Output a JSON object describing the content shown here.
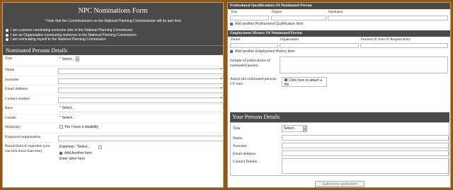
{
  "left": {
    "title": "NPC Nominations Form",
    "note": "* Note that the Commissioners on the National Planning Commissioner will be part time",
    "radios": [
      "I am a person nominating someone else to the National Planning Commission",
      "I am an Organisation nominating someone to the National Planning Commission",
      "I am nominating myself to the National Planning Commission"
    ],
    "section_title": "Nominated Persons Details",
    "fields": {
      "title": "Title",
      "title_select": "Select...",
      "name": "Name",
      "surname": "Surname",
      "email": "Email Address",
      "contact": "Contact number",
      "race": "Race",
      "race_select": "Select...",
      "gender": "Gender",
      "gender_select": "Select...",
      "disability": "Disability",
      "disability_check": "Yes I have a disability",
      "employer": "Employer/organisation",
      "broad_field": "Broad field of expertise (you can tick more than one)",
      "expertise_label": "Expertise:",
      "expertise_select": "Select...",
      "add_item": "Add Another Item",
      "enter_other": "Enter other here"
    },
    "required_mark": "*"
  },
  "right": {
    "pq_title": "Professional Qualifications Of Nominated Person",
    "pq_cols": [
      "Year",
      "Degree",
      "Institution"
    ],
    "pq_add": "Add another Professional Qualification Item",
    "eh_title": "Employment History Of Nominated Person",
    "eh_cols": [
      "Period",
      "Organisation",
      "Position Or Area Of Responsibility"
    ],
    "eh_add": "Add another Employment History Item",
    "sample_label": "Sample of publications of nominated person",
    "cv_label": "Attach the nominated persons CV here",
    "cv_button": "Click here to attach a file",
    "ypd_title": "Your Persons Details",
    "ypd_fields": {
      "title": "Title",
      "title_select": "Select...",
      "name": "Name",
      "surname": "Surname",
      "email": "Email Address",
      "contact": "Contact Details"
    },
    "submit": "Submit my application"
  }
}
